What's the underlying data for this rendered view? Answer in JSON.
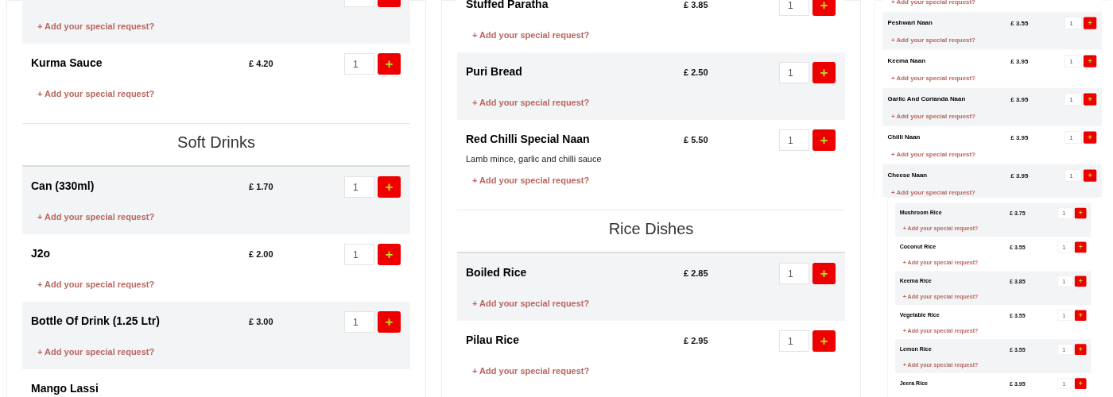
{
  "panels": [
    {
      "kind": "full",
      "blocks": [
        {
          "kind": "item",
          "shaded": true,
          "controls": true,
          "request": "+ Add your special request?"
        },
        {
          "kind": "item",
          "shaded": false,
          "name": "Kurma Sauce",
          "price": "£ 4.20",
          "quantity": "1",
          "button": "+",
          "request": "+ Add your special request?"
        },
        {
          "kind": "heading",
          "title": "Soft Drinks"
        },
        {
          "kind": "item",
          "shaded": true,
          "name": "Can (330ml)",
          "price": "£ 1.70",
          "quantity": "1",
          "button": "+",
          "request": "+ Add your special request?"
        },
        {
          "kind": "item",
          "shaded": false,
          "name": "J2o",
          "price": "£ 2.00",
          "quantity": "1",
          "button": "+",
          "request": "+ Add your special request?"
        },
        {
          "kind": "item",
          "shaded": true,
          "name": "Bottle Of Drink (1.25 Ltr)",
          "price": "£ 3.00",
          "quantity": "1",
          "button": "+",
          "request": "+ Add your special request?"
        },
        {
          "kind": "item",
          "shaded": false,
          "name": "Mango Lassi"
        }
      ]
    },
    {
      "kind": "full",
      "blocks": [
        {
          "kind": "item",
          "shaded": false,
          "name": "Stuffed Paratha",
          "price": "£ 3.85",
          "quantity": "1",
          "button": "+",
          "request": "+ Add your special request?"
        },
        {
          "kind": "item",
          "shaded": true,
          "name": "Puri Bread",
          "price": "£ 2.50",
          "quantity": "1",
          "button": "+",
          "request": "+ Add your special request?"
        },
        {
          "kind": "item",
          "shaded": false,
          "name": "Red Chilli Special Naan",
          "price": "£ 5.50",
          "quantity": "1",
          "button": "+",
          "description": "Lamb mince, garlic and chilli sauce",
          "request": "+ Add your special request?"
        },
        {
          "kind": "heading",
          "title": "Rice Dishes"
        },
        {
          "kind": "item",
          "shaded": true,
          "name": "Boiled Rice",
          "price": "£ 2.85",
          "quantity": "1",
          "button": "+",
          "request": "+ Add your special request?"
        },
        {
          "kind": "item",
          "shaded": false,
          "name": "Pilau Rice",
          "price": "£ 2.95",
          "quantity": "1",
          "button": "+",
          "request": "+ Add your special request?"
        }
      ]
    },
    {
      "kind": "mini",
      "blocks": [
        {
          "kind": "item",
          "shaded": false,
          "request": "+ Add your special request?"
        },
        {
          "kind": "item",
          "shaded": true,
          "name": "Peshwari Naan",
          "price": "£ 3.55",
          "quantity": "1",
          "button": "+",
          "request": "+ Add your special request?"
        },
        {
          "kind": "item",
          "shaded": false,
          "name": "Keema Naan",
          "price": "£ 3.95",
          "quantity": "1",
          "button": "+",
          "request": "+ Add your special request?"
        },
        {
          "kind": "item",
          "shaded": true,
          "name": "Garlic And Corianda Naan",
          "price": "£ 3.95",
          "quantity": "1",
          "button": "+",
          "request": "+ Add your special request?"
        },
        {
          "kind": "item",
          "shaded": false,
          "name": "Chilli Naan",
          "price": "£ 3.95",
          "quantity": "1",
          "button": "+",
          "request": "+ Add your special request?"
        },
        {
          "kind": "item",
          "shaded": true,
          "name": "Cheese Naan",
          "price": "£ 3.95",
          "quantity": "1",
          "button": "+",
          "request": "+ Add your special request?"
        }
      ]
    },
    {
      "kind": "mini",
      "blocks": [
        {
          "kind": "item",
          "shaded": true,
          "name": "Mushroom Rice",
          "price": "£ 3.75",
          "quantity": "1",
          "button": "+",
          "request": "+ Add your special request?"
        },
        {
          "kind": "item",
          "shaded": false,
          "name": "Coconut Rice",
          "price": "£ 3.55",
          "quantity": "1",
          "button": "+",
          "request": "+ Add your special request?"
        },
        {
          "kind": "item",
          "shaded": true,
          "name": "Keema Rice",
          "price": "£ 3.85",
          "quantity": "1",
          "button": "+",
          "request": "+ Add your special request?"
        },
        {
          "kind": "item",
          "shaded": false,
          "name": "Vegetable Rice",
          "price": "£ 3.55",
          "quantity": "1",
          "button": "+",
          "request": "+ Add your special request?"
        },
        {
          "kind": "item",
          "shaded": true,
          "name": "Lemon Rice",
          "price": "£ 3.55",
          "quantity": "1",
          "button": "+",
          "request": "+ Add your special request?"
        },
        {
          "kind": "item",
          "shaded": false,
          "name": "Jeera Rice",
          "price": "£ 3.95",
          "quantity": "1",
          "button": "+"
        }
      ]
    }
  ]
}
